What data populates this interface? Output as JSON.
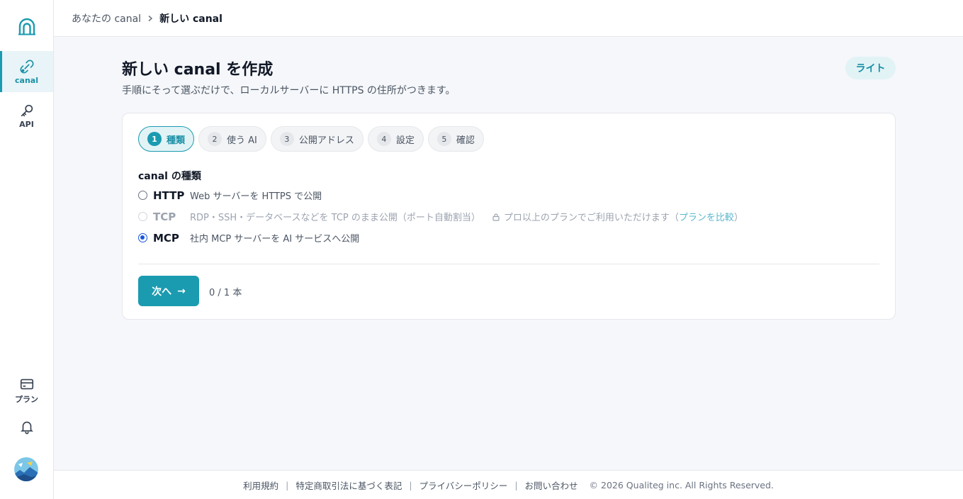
{
  "sidebar": {
    "logo_icon": "tunnel-logo-icon",
    "items": [
      {
        "label": "canal",
        "icon": "link-icon",
        "active": true
      },
      {
        "label": "API",
        "icon": "key-icon",
        "active": false
      },
      {
        "label": "プラン",
        "icon": "card-icon",
        "active": false
      }
    ],
    "bell_icon": "bell-icon",
    "avatar_icon": "avatar-image"
  },
  "breadcrumb": {
    "parent": "あなたの canal",
    "current": "新しい canal"
  },
  "header": {
    "title": "新しい canal を作成",
    "subtitle": "手順にそって選ぶだけで、ローカルサーバーに HTTPS の住所がつきます。",
    "mode_badge": "ライト"
  },
  "steps": [
    {
      "num": "1",
      "label": "種類",
      "active": true
    },
    {
      "num": "2",
      "label": "使う AI",
      "active": false
    },
    {
      "num": "3",
      "label": "公開アドレス",
      "active": false
    },
    {
      "num": "4",
      "label": "設定",
      "active": false
    },
    {
      "num": "5",
      "label": "確認",
      "active": false
    }
  ],
  "form": {
    "section_label": "canal の種類",
    "options": [
      {
        "name": "HTTP",
        "desc": "Web サーバーを HTTPS で公開",
        "checked": false,
        "disabled": false
      },
      {
        "name": "TCP",
        "desc": "RDP・SSH・データベースなどを TCP のまま公開（ポート自動割当）",
        "checked": false,
        "disabled": true
      },
      {
        "name": "MCP",
        "desc": "社内 MCP サーバーを AI サービスへ公開",
        "checked": true,
        "disabled": false
      }
    ],
    "tcp_note_prefix": "プロ以上のプランでご利用いただけます（",
    "tcp_note_link": "プランを比較",
    "tcp_note_suffix": "）",
    "next_label": "次へ",
    "next_arrow": "→",
    "count": "0 / 1 本"
  },
  "footer": {
    "links": [
      "利用規約",
      "特定商取引法に基づく表記",
      "プライバシーポリシー",
      "お問い合わせ"
    ],
    "copyright": "© 2026 Qualiteg inc. All Rights Reserved."
  },
  "colors": {
    "accent": "#1a9bb0",
    "accent_light": "#e2f3f6",
    "radio_checked": "#1a56db",
    "background": "#f5f7fa"
  }
}
